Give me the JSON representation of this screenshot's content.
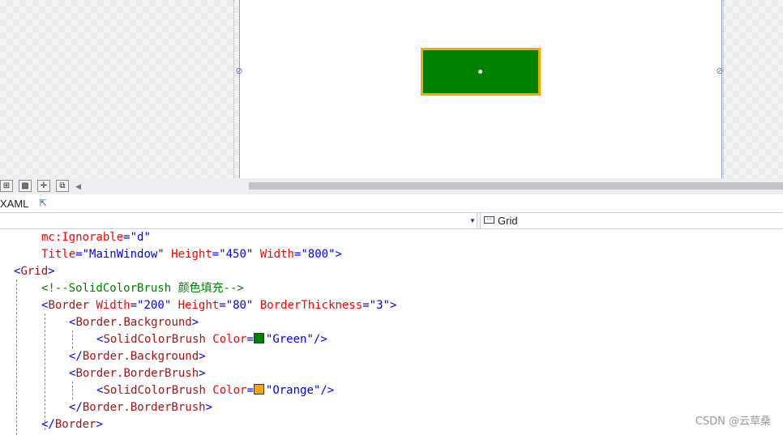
{
  "designer": {
    "preview": {
      "fill_color": "#008000",
      "border_color": "#ffa500"
    },
    "anchor_icon": "chain-link-icon"
  },
  "zoom_bar": {
    "buttons": [
      {
        "name": "grid-toggle-icon",
        "glyph": "⊞"
      },
      {
        "name": "checker-toggle-icon",
        "glyph": "▩"
      },
      {
        "name": "snap-toggle-icon",
        "glyph": "✛"
      },
      {
        "name": "snapline-toggle-icon",
        "glyph": "⧉"
      }
    ],
    "scroll_left_glyph": "◀"
  },
  "tabs": {
    "xaml_label": "XAML",
    "popout_glyph": "⇱"
  },
  "nav": {
    "dropdown_glyph": "▼",
    "element_label": "Grid"
  },
  "code": {
    "l1_attr": "mc:Ignorable",
    "l1_eq": "=",
    "l1_val": "\"d\"",
    "l2_attr1": "Title",
    "l2_eq1": "=",
    "l2_val1": "\"MainWindow\"",
    "l2_attr2": " Height",
    "l2_eq2": "=",
    "l2_val2": "\"450\"",
    "l2_attr3": " Width",
    "l2_eq3": "=",
    "l2_val3": "\"800\"",
    "l2_close": ">",
    "l3_open": "<",
    "l3_tag": "Grid",
    "l3_close": ">",
    "l4_comment": "<!--SolidColorBrush 颜色填充-->",
    "l5_open": "<",
    "l5_tag": "Border",
    "l5_attr1": " Width",
    "l5_eq1": "=",
    "l5_val1": "\"200\"",
    "l5_attr2": " Height",
    "l5_eq2": "=",
    "l5_val2": "\"80\"",
    "l5_attr3": " BorderThickness",
    "l5_eq3": "=",
    "l5_val3": "\"3\"",
    "l5_close": ">",
    "l6_open": "<",
    "l6_tag": "Border.Background",
    "l6_close": ">",
    "l7_open": "<",
    "l7_tag": "SolidColorBrush",
    "l7_attr": " Color",
    "l7_eq": "=",
    "l7_val": "\"Green\"",
    "l7_close": "/>",
    "l7_swatch": "#008000",
    "l8_open": "</",
    "l8_tag": "Border.Background",
    "l8_close": ">",
    "l9_open": "<",
    "l9_tag": "Border.BorderBrush",
    "l9_close": ">",
    "l10_open": "<",
    "l10_tag": "SolidColorBrush",
    "l10_attr": " Color",
    "l10_eq": "=",
    "l10_val": "\"Orange\"",
    "l10_close": "/>",
    "l10_swatch": "#ffa500",
    "l11_open": "</",
    "l11_tag": "Border.BorderBrush",
    "l11_close": ">",
    "l12_open": "</",
    "l12_tag": "Border",
    "l12_close": ">"
  },
  "watermark": "CSDN @云草桑"
}
